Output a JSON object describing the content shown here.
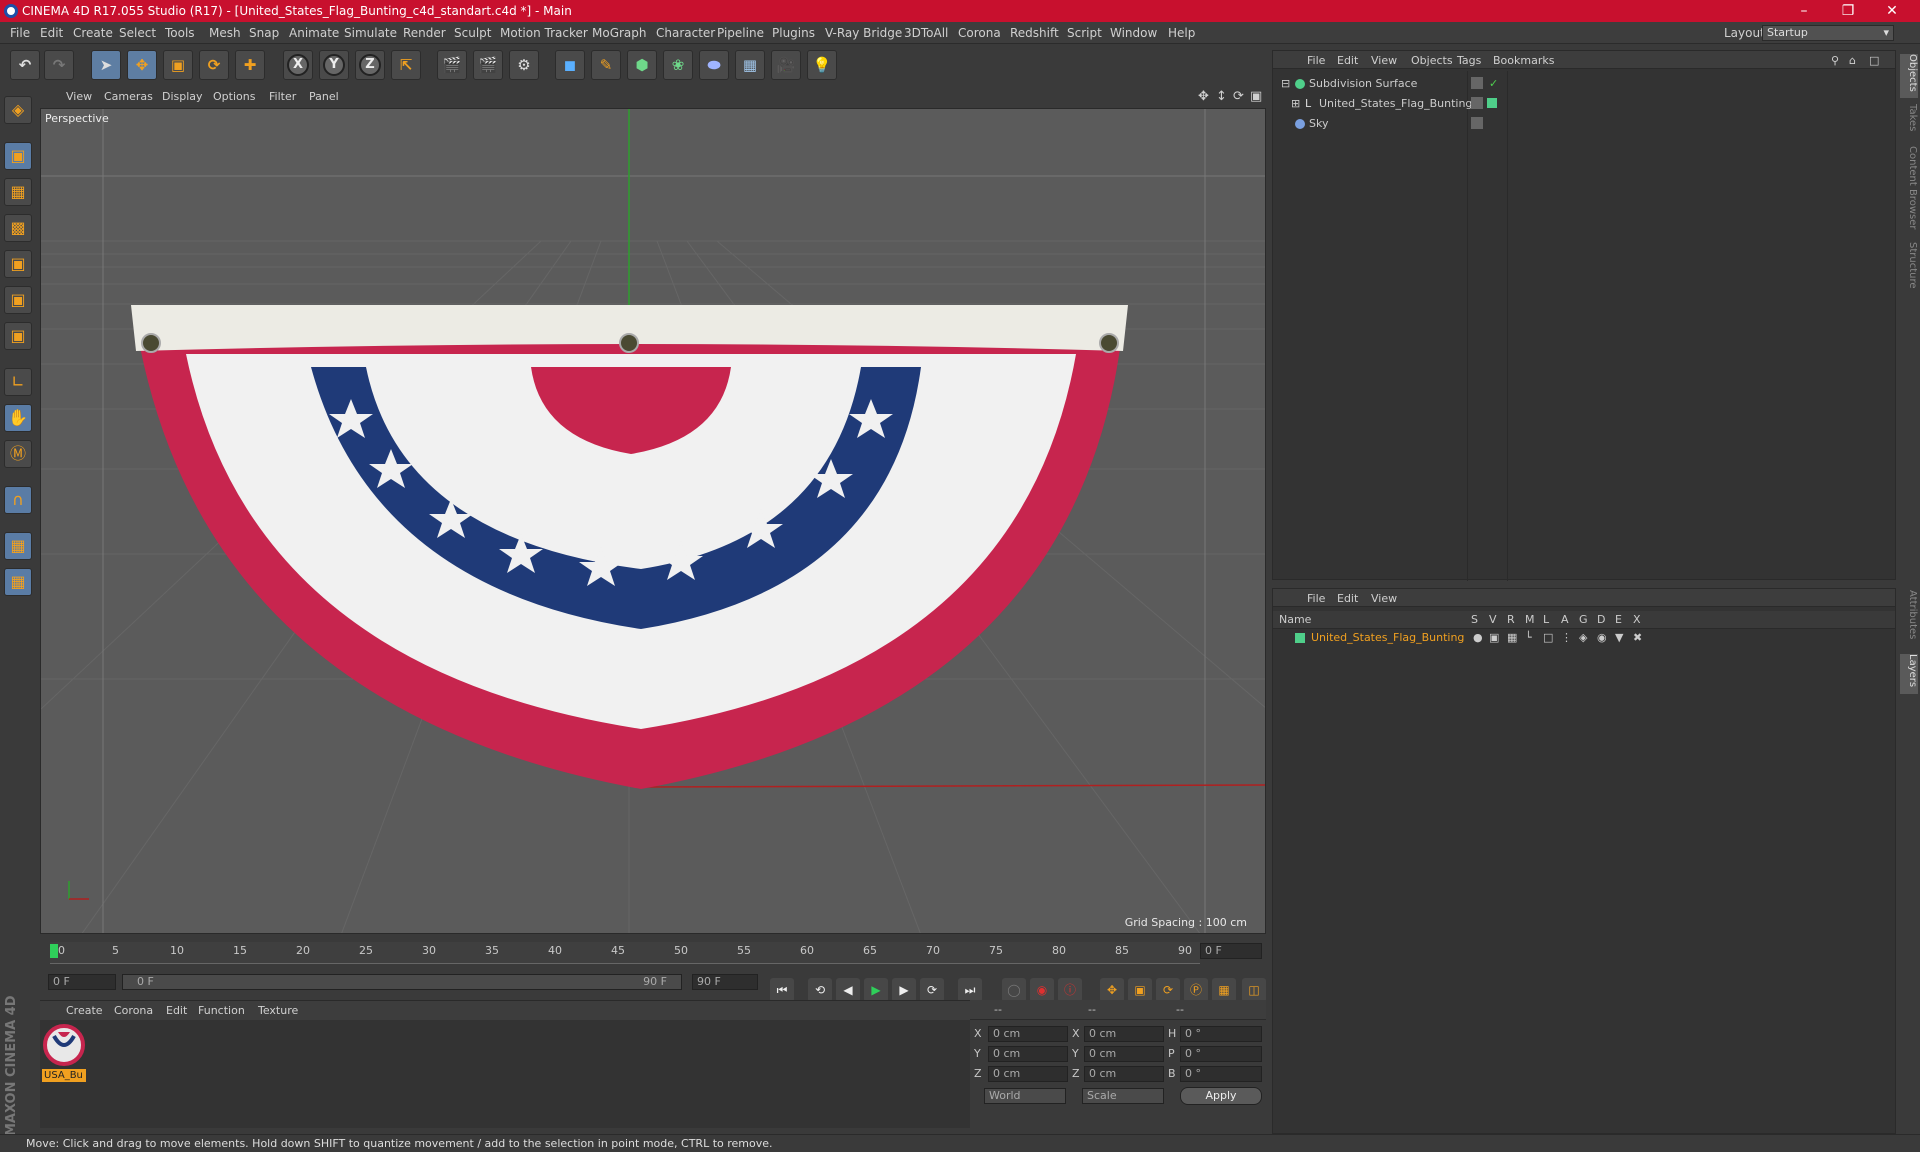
{
  "title": "CINEMA 4D R17.055 Studio (R17) - [United_States_Flag_Bunting_c4d_standart.c4d *] - Main",
  "menu": [
    "File",
    "Edit",
    "Create",
    "Select",
    "Tools",
    "Mesh",
    "Snap",
    "Animate",
    "Simulate",
    "Render",
    "Sculpt",
    "Motion Tracker",
    "MoGraph",
    "Character",
    "Pipeline",
    "Plugins",
    "V-Ray Bridge",
    "3DToAll",
    "Corona",
    "Redshift",
    "Script",
    "Window",
    "Help"
  ],
  "layout": {
    "label": "Layout:",
    "value": "Startup"
  },
  "viewport": {
    "menu": [
      "View",
      "Cameras",
      "Display",
      "Options",
      "Filter",
      "Panel"
    ],
    "label": "Perspective",
    "grid_spacing": "Grid Spacing : 100 cm"
  },
  "timeline": {
    "ticks": [
      "0",
      "5",
      "10",
      "15",
      "20",
      "25",
      "30",
      "35",
      "40",
      "45",
      "50",
      "55",
      "60",
      "65",
      "70",
      "75",
      "80",
      "85",
      "90"
    ],
    "current": "0 F",
    "start": "0 F",
    "range_start": "0 F",
    "range_end": "90 F",
    "end": "90 F"
  },
  "material_menu": [
    "Create",
    "Corona",
    "Edit",
    "Function",
    "Texture"
  ],
  "material": {
    "name": "USA_Bu"
  },
  "coords": {
    "headers": [
      "--",
      "--",
      "--"
    ],
    "rows": [
      {
        "a": "X",
        "av": "0 cm",
        "b": "X",
        "bv": "0 cm",
        "c": "H",
        "cv": "0 °"
      },
      {
        "a": "Y",
        "av": "0 cm",
        "b": "Y",
        "bv": "0 cm",
        "c": "P",
        "cv": "0 °"
      },
      {
        "a": "Z",
        "av": "0 cm",
        "b": "Z",
        "bv": "0 cm",
        "c": "B",
        "cv": "0 °"
      }
    ],
    "space": "World",
    "mode": "Scale",
    "apply": "Apply"
  },
  "status": "Move: Click and drag to move elements. Hold down SHIFT to quantize movement / add to the selection in point mode, CTRL to remove.",
  "objects_menu": [
    "File",
    "Edit",
    "View",
    "Objects",
    "Tags",
    "Bookmarks"
  ],
  "objects": [
    {
      "name": "Subdivision Surface",
      "color": "#4fcf8a"
    },
    {
      "name": "United_States_Flag_Bunting",
      "color": "#4fcf8a"
    },
    {
      "name": "Sky",
      "color": "#7aa0e0"
    }
  ],
  "layers_menu": [
    "File",
    "Edit",
    "View"
  ],
  "layers_header": {
    "name": "Name",
    "cols": [
      "S",
      "V",
      "R",
      "M",
      "L",
      "A",
      "G",
      "D",
      "E",
      "X"
    ]
  },
  "layers": [
    {
      "name": "United_States_Flag_Bunting",
      "color": "#f0a020"
    }
  ],
  "side_tabs": [
    "Objects",
    "Takes",
    "Content Browser",
    "Structure",
    "Attributes",
    "Layers"
  ],
  "brand": "MAXON CINEMA 4D",
  "colors": {
    "title_bar": "#c8102e",
    "accent": "#f0a020",
    "flag_red": "#c7254e",
    "flag_blue": "#1f3a78"
  }
}
